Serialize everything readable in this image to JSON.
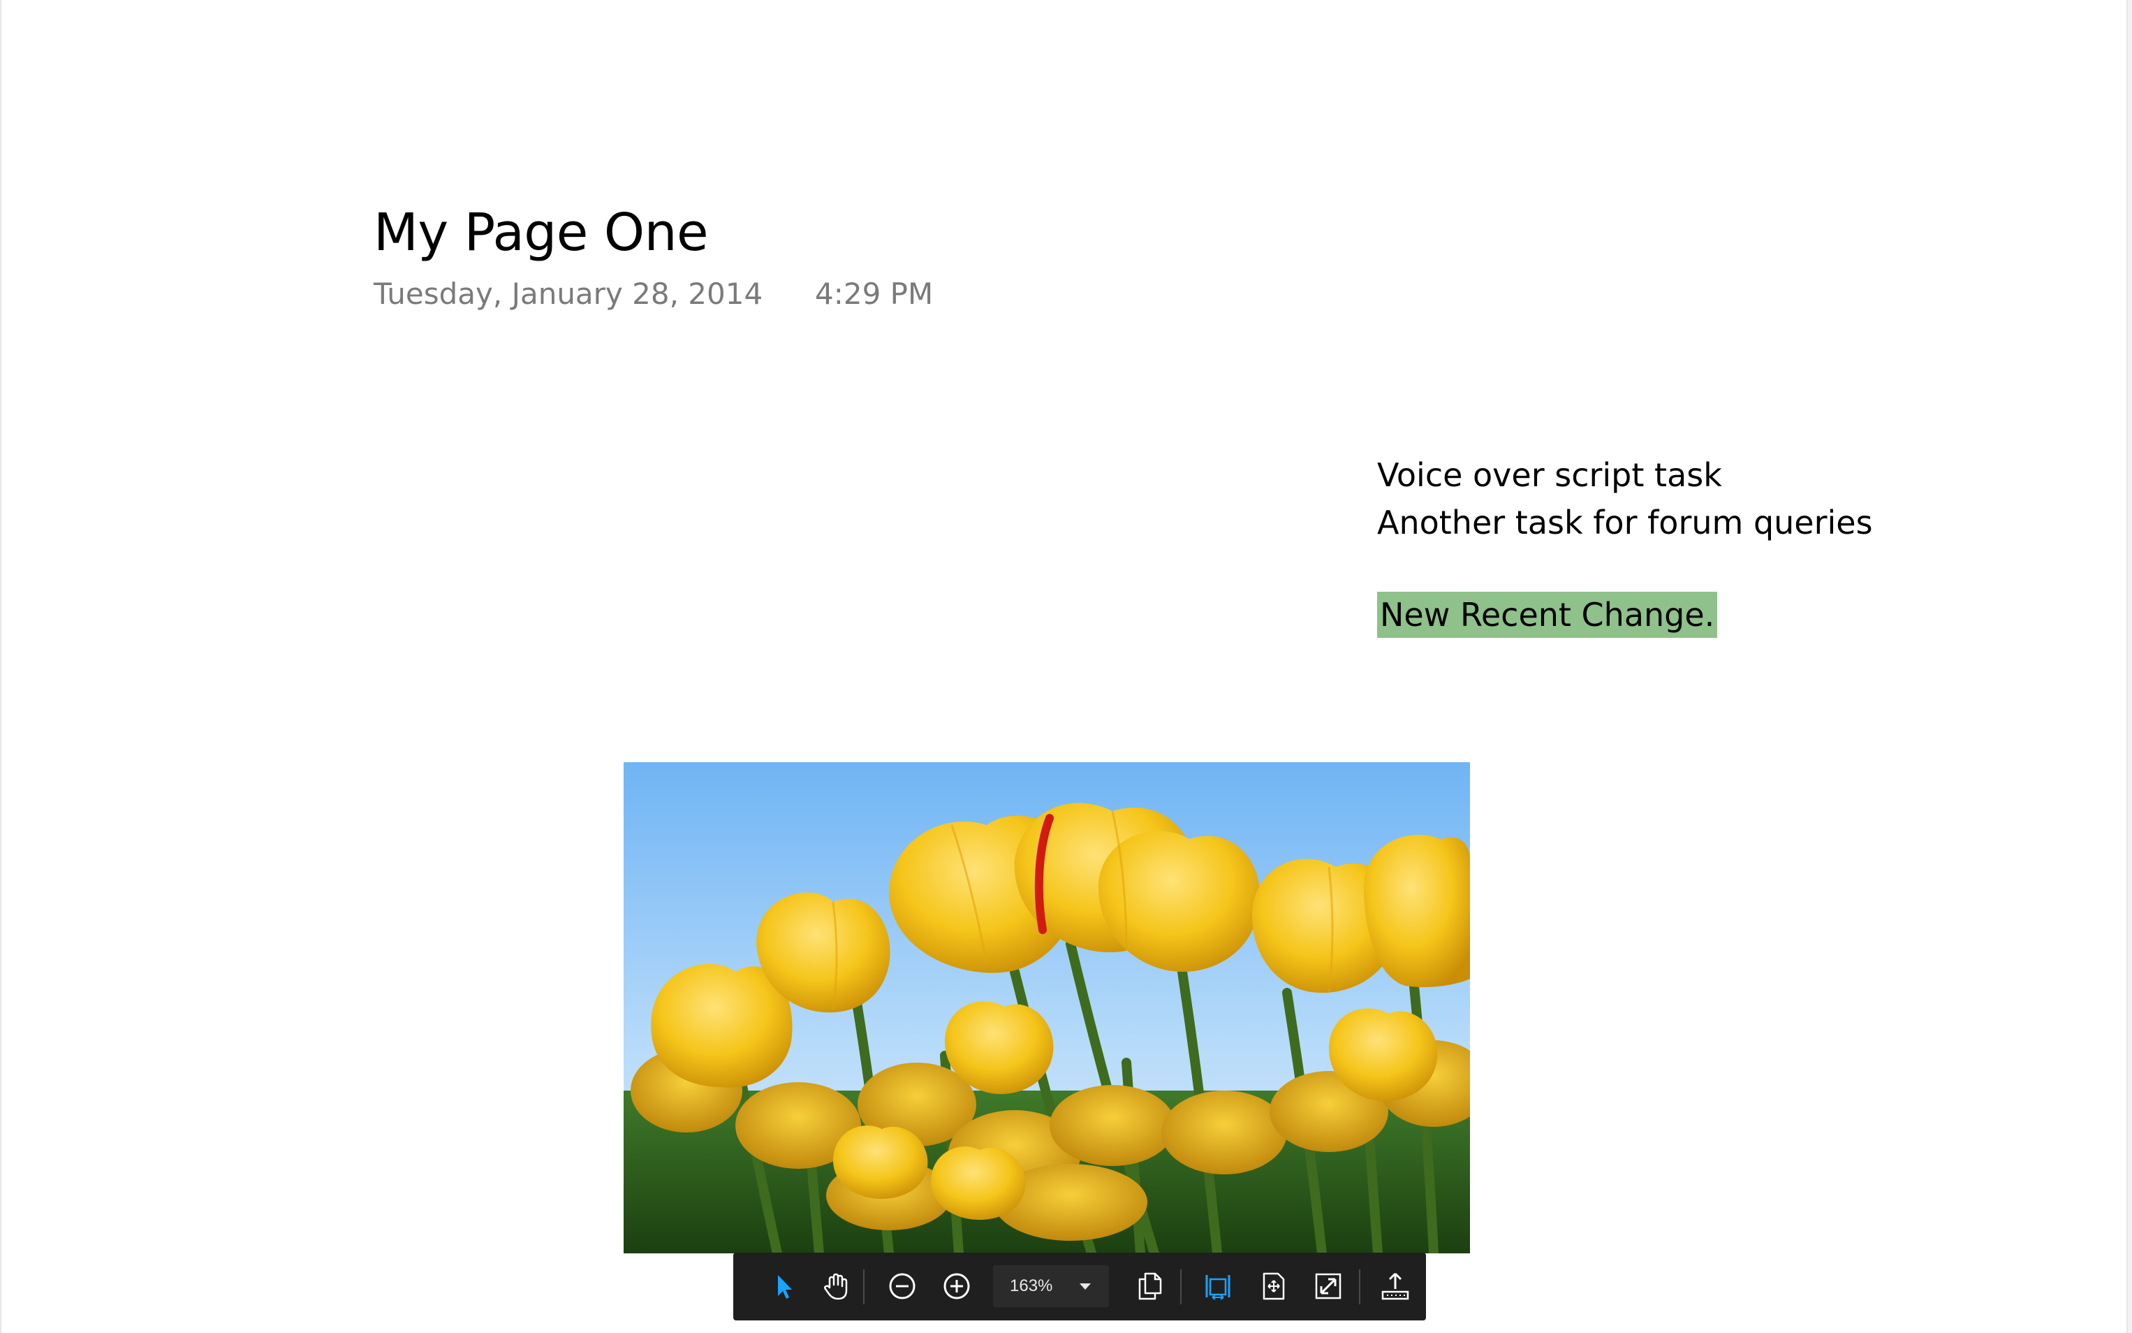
{
  "page": {
    "title": "My Page One",
    "date": "Tuesday, January 28, 2014",
    "time": "4:29 PM"
  },
  "note": {
    "lines": [
      "Voice over script task",
      "Another task for forum queries"
    ],
    "highlighted": "New Recent Change.",
    "highlight_color": "#8fc18a"
  },
  "picture": {
    "subject": "yellow-tulips-photo"
  },
  "toolbar": {
    "zoom_value": "163%",
    "icons": [
      "select-arrow-icon",
      "hand-pan-icon",
      "zoom-out-icon",
      "zoom-in-icon",
      "zoom-dropdown-chevron-icon",
      "copy-pages-icon",
      "fit-width-icon",
      "fit-page-icon",
      "fullscreen-icon",
      "export-icon"
    ],
    "colors": {
      "background": "#1f1f1f",
      "active_icon": "#1aa3ff",
      "icon": "#ffffff"
    }
  }
}
